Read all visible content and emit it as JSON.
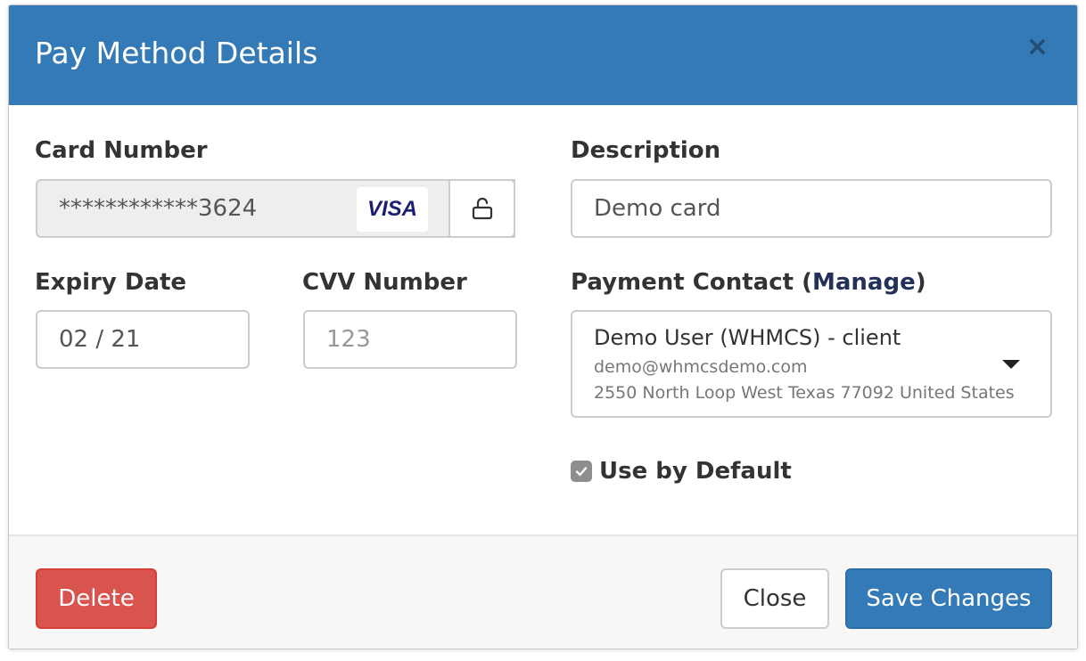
{
  "header": {
    "title": "Pay Method Details",
    "close_glyph": "×"
  },
  "form": {
    "card_number": {
      "label": "Card Number",
      "value": "************3624",
      "brand": "VISA",
      "lock_icon": "unlock-icon"
    },
    "description": {
      "label": "Description",
      "value": "Demo card"
    },
    "expiry": {
      "label": "Expiry Date",
      "value": "02 / 21"
    },
    "cvv": {
      "label": "CVV Number",
      "placeholder": "123"
    },
    "payment_contact": {
      "label": "Payment Contact",
      "open_paren": " (",
      "manage_label": "Manage",
      "close_paren": ")",
      "name": "Demo User (WHMCS) - client",
      "email": "demo@whmcsdemo.com",
      "address": "2550 North Loop West Texas 77092 United States"
    },
    "use_by_default": {
      "label": "Use by Default",
      "checked": true
    }
  },
  "footer": {
    "delete_label": "Delete",
    "close_label": "Close",
    "save_label": "Save Changes"
  },
  "colors": {
    "primary": "#337ab7",
    "danger": "#d9534f",
    "link": "#23305a"
  }
}
